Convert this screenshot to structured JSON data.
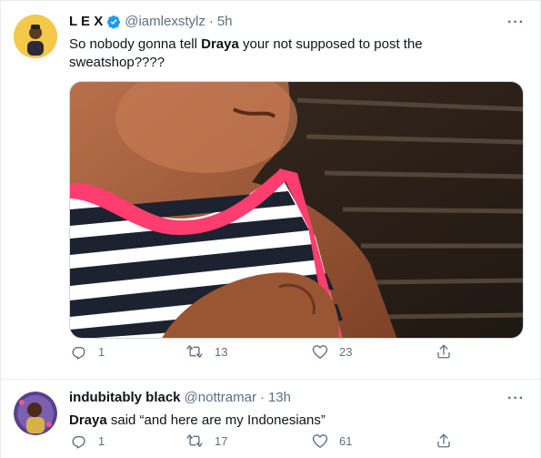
{
  "tweet1": {
    "name": "L E X",
    "handle": "@iamlexstylz",
    "dot": "·",
    "time": "5h",
    "more": "···",
    "text": {
      "part1": "So nobody gonna tell ",
      "bold": "Draya",
      "part2": " your not supposed to post the sweatshop????"
    },
    "counts": {
      "reply": "1",
      "retweet": "13",
      "like": "23"
    }
  },
  "tweet2": {
    "name": "indubitably black",
    "handle": "@nottramar",
    "dot": "·",
    "time": "13h",
    "more": "···",
    "text": {
      "bold": "Draya",
      "rest": " said “and here are my Indonesians”"
    },
    "counts": {
      "reply": "1",
      "retweet": "17",
      "like": "61"
    }
  },
  "icons": {
    "verified": "verified-badge-icon",
    "reply": "reply-icon",
    "retweet": "retweet-icon",
    "like": "heart-icon",
    "share": "share-icon",
    "more": "more-icon"
  },
  "colors": {
    "verified": "#1d9bf0",
    "muted": "#5b7083",
    "divider": "#e6ecf0"
  }
}
